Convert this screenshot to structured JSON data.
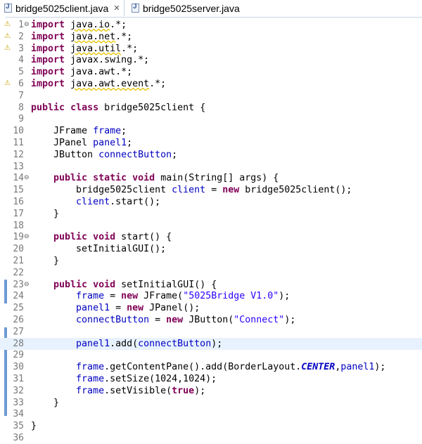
{
  "tabs": [
    {
      "label": "bridge5025client.java",
      "close": "✕",
      "active": true
    },
    {
      "label": "bridge5025server.java",
      "active": false
    }
  ],
  "editor": {
    "current_line": 28,
    "lines": [
      {
        "n": "1",
        "fold": true,
        "warn": true,
        "tokens": [
          [
            "kw",
            "import"
          ],
          [
            "p",
            " "
          ],
          [
            "imp",
            "java.io"
          ],
          [
            "p",
            ".*;"
          ]
        ]
      },
      {
        "n": "2",
        "warn": true,
        "tokens": [
          [
            "kw",
            "import"
          ],
          [
            "p",
            " "
          ],
          [
            "imp",
            "java.net"
          ],
          [
            "p",
            ".*;"
          ]
        ]
      },
      {
        "n": "3",
        "warn": true,
        "tokens": [
          [
            "kw",
            "import"
          ],
          [
            "p",
            " "
          ],
          [
            "imp",
            "java.util"
          ],
          [
            "p",
            ".*;"
          ]
        ]
      },
      {
        "n": "4",
        "tokens": [
          [
            "kw",
            "import"
          ],
          [
            "p",
            " javax.swing.*;"
          ]
        ]
      },
      {
        "n": "5",
        "tokens": [
          [
            "kw",
            "import"
          ],
          [
            "p",
            " java.awt.*;"
          ]
        ]
      },
      {
        "n": "6",
        "warn": true,
        "tokens": [
          [
            "kw",
            "import"
          ],
          [
            "p",
            " "
          ],
          [
            "imp",
            "java.awt.event"
          ],
          [
            "p",
            ".*;"
          ]
        ]
      },
      {
        "n": "7",
        "tokens": []
      },
      {
        "n": "8",
        "tokens": [
          [
            "kw",
            "public"
          ],
          [
            "p",
            " "
          ],
          [
            "kw",
            "class"
          ],
          [
            "p",
            " bridge5025client {"
          ]
        ]
      },
      {
        "n": "9",
        "tokens": []
      },
      {
        "n": "10",
        "tokens": [
          [
            "p",
            "    JFrame "
          ],
          [
            "fld",
            "frame"
          ],
          [
            "p",
            ";"
          ]
        ]
      },
      {
        "n": "11",
        "tokens": [
          [
            "p",
            "    JPanel "
          ],
          [
            "fld",
            "panel1"
          ],
          [
            "p",
            ";"
          ]
        ]
      },
      {
        "n": "12",
        "tokens": [
          [
            "p",
            "    JButton "
          ],
          [
            "fld",
            "connectButton"
          ],
          [
            "p",
            ";"
          ]
        ]
      },
      {
        "n": "13",
        "tokens": []
      },
      {
        "n": "14",
        "fold": true,
        "tokens": [
          [
            "p",
            "    "
          ],
          [
            "kw",
            "public"
          ],
          [
            "p",
            " "
          ],
          [
            "kw",
            "static"
          ],
          [
            "p",
            " "
          ],
          [
            "kw",
            "void"
          ],
          [
            "p",
            " main(String[] args) {"
          ]
        ]
      },
      {
        "n": "15",
        "tokens": [
          [
            "p",
            "        bridge5025client "
          ],
          [
            "fld",
            "client"
          ],
          [
            "p",
            " = "
          ],
          [
            "kw",
            "new"
          ],
          [
            "p",
            " bridge5025client();"
          ]
        ]
      },
      {
        "n": "16",
        "tokens": [
          [
            "p",
            "        "
          ],
          [
            "fld",
            "client"
          ],
          [
            "p",
            ".start();"
          ]
        ]
      },
      {
        "n": "17",
        "tokens": [
          [
            "p",
            "    }"
          ]
        ]
      },
      {
        "n": "18",
        "tokens": []
      },
      {
        "n": "19",
        "fold": true,
        "tokens": [
          [
            "p",
            "    "
          ],
          [
            "kw",
            "public"
          ],
          [
            "p",
            " "
          ],
          [
            "kw",
            "void"
          ],
          [
            "p",
            " start() {"
          ]
        ]
      },
      {
        "n": "20",
        "tokens": [
          [
            "p",
            "        setInitialGUI();"
          ]
        ]
      },
      {
        "n": "21",
        "tokens": [
          [
            "p",
            "    }"
          ]
        ]
      },
      {
        "n": "22",
        "tokens": []
      },
      {
        "n": "23",
        "fold": true,
        "tokens": [
          [
            "p",
            "    "
          ],
          [
            "kw",
            "public"
          ],
          [
            "p",
            " "
          ],
          [
            "kw",
            "void"
          ],
          [
            "p",
            " setInitialGUI() {"
          ]
        ]
      },
      {
        "n": "24",
        "tokens": [
          [
            "p",
            "        "
          ],
          [
            "fld",
            "frame"
          ],
          [
            "p",
            " = "
          ],
          [
            "kw",
            "new"
          ],
          [
            "p",
            " JFrame("
          ],
          [
            "str",
            "\"5025Bridge V1.0\""
          ],
          [
            "p",
            ");"
          ]
        ]
      },
      {
        "n": "25",
        "tokens": [
          [
            "p",
            "        "
          ],
          [
            "fld",
            "panel1"
          ],
          [
            "p",
            " = "
          ],
          [
            "kw",
            "new"
          ],
          [
            "p",
            " JPanel();"
          ]
        ]
      },
      {
        "n": "26",
        "tokens": [
          [
            "p",
            "        "
          ],
          [
            "fld",
            "connectButton"
          ],
          [
            "p",
            " = "
          ],
          [
            "kw",
            "new"
          ],
          [
            "p",
            " JButton("
          ],
          [
            "str",
            "\"Connect\""
          ],
          [
            "p",
            ");"
          ]
        ]
      },
      {
        "n": "27",
        "tokens": []
      },
      {
        "n": "28",
        "tokens": [
          [
            "p",
            "        "
          ],
          [
            "fld",
            "panel1"
          ],
          [
            "p",
            ".add("
          ],
          [
            "fld",
            "connectButton"
          ],
          [
            "p",
            ");"
          ]
        ]
      },
      {
        "n": "29",
        "tokens": []
      },
      {
        "n": "30",
        "tokens": [
          [
            "p",
            "        "
          ],
          [
            "fld",
            "frame"
          ],
          [
            "p",
            ".getContentPane().add(BorderLayout."
          ],
          [
            "const",
            "CENTER"
          ],
          [
            "p",
            ","
          ],
          [
            "fld",
            "panel1"
          ],
          [
            "p",
            ");"
          ]
        ]
      },
      {
        "n": "31",
        "tokens": [
          [
            "p",
            "        "
          ],
          [
            "fld",
            "frame"
          ],
          [
            "p",
            ".setSize(1024,1024);"
          ]
        ]
      },
      {
        "n": "32",
        "tokens": [
          [
            "p",
            "        "
          ],
          [
            "fld",
            "frame"
          ],
          [
            "p",
            ".setVisible("
          ],
          [
            "kw",
            "true"
          ],
          [
            "p",
            ");"
          ]
        ]
      },
      {
        "n": "33",
        "tokens": [
          [
            "p",
            "    }"
          ]
        ]
      },
      {
        "n": "34",
        "tokens": []
      },
      {
        "n": "35",
        "tokens": [
          [
            "p",
            "}"
          ]
        ]
      },
      {
        "n": "36",
        "tokens": []
      }
    ]
  },
  "colors": {
    "keyword": "#7f0055",
    "field": "#0000c0",
    "string": "#2a00ff",
    "line_number": "#787878",
    "current_line_bg": "#e8f2fe",
    "change_bar": "#6f9ad3"
  },
  "icons": {
    "file_tab": "java-file-icon",
    "warning": "lightbulb-warning-icon",
    "fold": "collapse-triangle-icon",
    "close": "close-icon"
  }
}
